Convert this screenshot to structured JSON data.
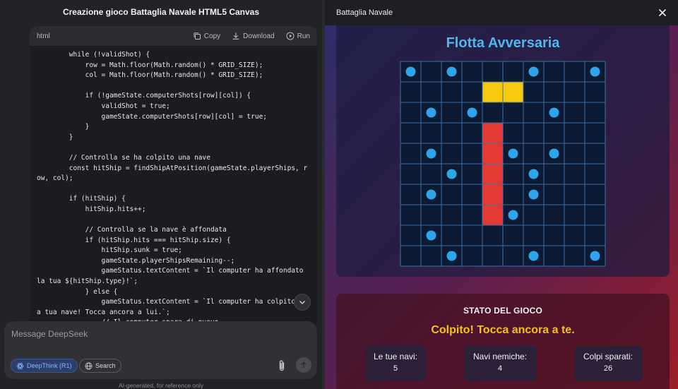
{
  "left": {
    "title": "Creazione gioco Battaglia Navale HTML5 Canvas",
    "code": {
      "lang": "html",
      "copy_label": "Copy",
      "download_label": "Download",
      "run_label": "Run",
      "lines": [
        "        while (!validShot) {",
        "            row = Math.floor(Math.random() * GRID_SIZE);",
        "            col = Math.floor(Math.random() * GRID_SIZE);",
        "",
        "            if (!gameState.computerShots[row][col]) {",
        "                validShot = true;",
        "                gameState.computerShots[row][col] = true;",
        "            }",
        "        }",
        "",
        "        // Controlla se ha colpito una nave",
        "        const hitShip = findShipAtPosition(gameState.playerShips, row, col);",
        "",
        "        if (hitShip) {",
        "            hitShip.hits++;",
        "",
        "            // Controlla se la nave è affondata",
        "            if (hitShip.hits === hitShip.size) {",
        "                hitShip.sunk = true;",
        "                gameState.playerShipsRemaining--;",
        "                gameStatus.textContent = `Il computer ha affondato la tua ${hitShip.type}!`;",
        "            } else {",
        "                gameStatus.textContent = `Il computer ha colpito una tua nave! Tocca ancora a lui.`;",
        "                // Il computer spara di nuovo"
      ]
    },
    "composer": {
      "placeholder": "Message DeepSeek",
      "deepthink_label": "DeepThink (R1)",
      "search_label": "Search"
    },
    "disclaimer": "AI-generated, for reference only"
  },
  "right": {
    "title": "Battaglia Navale",
    "fleet_title": "Flotta Avversaria",
    "board": {
      "size": 10,
      "colors": {
        "water": "#0c1a33",
        "line": "#3d6fa3",
        "miss": "#2ea4ea",
        "hit": "#e53935",
        "ship": "#f6c90e"
      },
      "misses": [
        [
          0,
          0
        ],
        [
          0,
          2
        ],
        [
          0,
          6
        ],
        [
          0,
          9
        ],
        [
          2,
          1
        ],
        [
          2,
          3
        ],
        [
          2,
          7
        ],
        [
          4,
          1
        ],
        [
          4,
          5
        ],
        [
          4,
          7
        ],
        [
          5,
          2
        ],
        [
          5,
          6
        ],
        [
          6,
          1
        ],
        [
          6,
          6
        ],
        [
          7,
          5
        ],
        [
          8,
          1
        ],
        [
          9,
          2
        ],
        [
          9,
          6
        ],
        [
          9,
          9
        ]
      ],
      "hits": [
        [
          3,
          4
        ],
        [
          4,
          4
        ],
        [
          5,
          4
        ],
        [
          6,
          4
        ],
        [
          7,
          4
        ]
      ],
      "ships": [
        [
          1,
          4
        ],
        [
          1,
          5
        ]
      ]
    },
    "status": {
      "title": "STATO DEL GIOCO",
      "message": "Colpito! Tocca ancora a te.",
      "stats": [
        {
          "label": "Le tue navi:",
          "value": "5"
        },
        {
          "label": "Navi nemiche:",
          "value": "4"
        },
        {
          "label": "Colpi sparati:",
          "value": "26"
        }
      ]
    }
  }
}
